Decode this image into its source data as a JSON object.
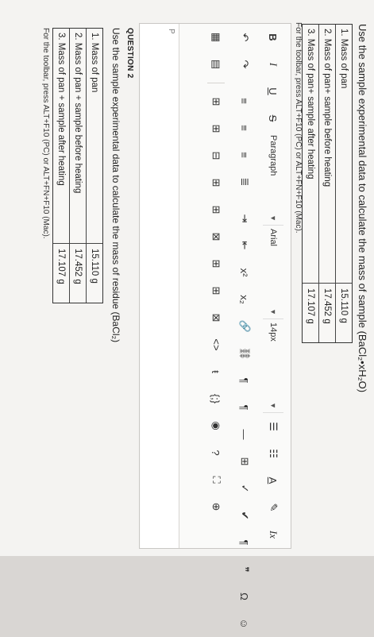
{
  "q1": {
    "title": "Use the sample experimental data to calculate the mass of sample (BaCl₂•xH₂O)",
    "rows": [
      {
        "label": "1. Mass of pan",
        "value": "15.110 g"
      },
      {
        "label": "2. Mass of pan+ sample before heating",
        "value": "17.452 g"
      },
      {
        "label": "3. Mass of pan+ sample after heating",
        "value": "17.107 g"
      }
    ],
    "toolbar_hint": "For the toolbar, press ALT+F10 (PC) or ALT+FN+F10 (Mac)."
  },
  "editor": {
    "paragraph": "Paragraph",
    "font": "Arial",
    "size": "14px",
    "path": "P"
  },
  "q2": {
    "label": "QUESTION 2",
    "title": "Use the sample experimental data to calculate the mass of residue (BaCl₂)",
    "rows": [
      {
        "label": "1. Mass of pan",
        "value": "15.110 g"
      },
      {
        "label": "2. Mass of pan + sample before heating",
        "value": "17.452 g"
      },
      {
        "label": "3. Mass of pan + sample after heating",
        "value": "17.107 g"
      }
    ],
    "toolbar_hint": "For the toolbar, press ALT+F10 (PC) or ALT+FN+F10 (Mac)."
  }
}
